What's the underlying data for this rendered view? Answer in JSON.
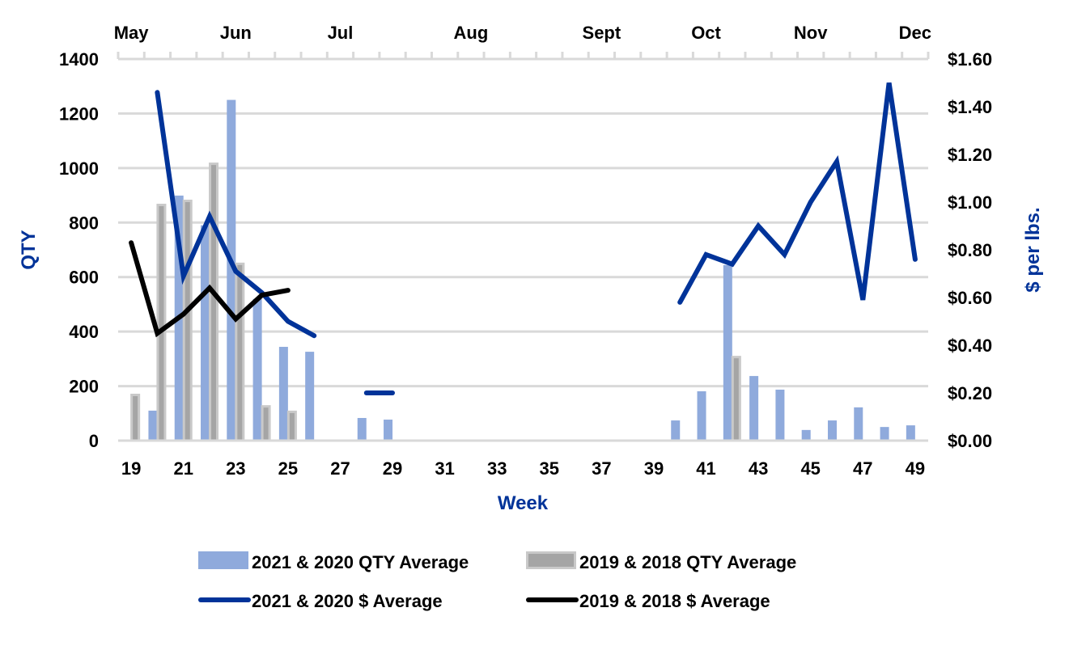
{
  "chart_data": {
    "type": "bar+line",
    "title": "",
    "xlabel": "Week",
    "ylabel": "QTY",
    "y2label": "$ per lbs.",
    "ylim": [
      0,
      1400
    ],
    "y2lim": [
      0,
      1.6
    ],
    "yticks": [
      0,
      200,
      400,
      600,
      800,
      1000,
      1200,
      1400
    ],
    "y2ticks": [
      "$0.00",
      "$0.20",
      "$0.40",
      "$0.60",
      "$0.80",
      "$1.00",
      "$1.20",
      "$1.40",
      "$1.60"
    ],
    "grid": true,
    "legend_position": "bottom",
    "x": [
      19,
      20,
      21,
      22,
      23,
      24,
      25,
      26,
      27,
      28,
      29,
      30,
      31,
      32,
      33,
      34,
      35,
      36,
      37,
      38,
      39,
      40,
      41,
      42,
      43,
      44,
      45,
      46,
      47,
      48,
      49
    ],
    "xtick_labels": [
      "19",
      "21",
      "23",
      "25",
      "27",
      "29",
      "31",
      "33",
      "35",
      "37",
      "39",
      "41",
      "43",
      "45",
      "47",
      "49"
    ],
    "month_labels": [
      {
        "label": "May",
        "week": 19
      },
      {
        "label": "Jun",
        "week": 23
      },
      {
        "label": "Jul",
        "week": 27
      },
      {
        "label": "Aug",
        "week": 32
      },
      {
        "label": "Sept",
        "week": 37
      },
      {
        "label": "Oct",
        "week": 41
      },
      {
        "label": "Nov",
        "week": 45
      },
      {
        "label": "Dec",
        "week": 49
      }
    ],
    "series": [
      {
        "name": "2021 & 2020 QTY Average",
        "kind": "bar",
        "axis": "left",
        "color": "#8faadc",
        "values": [
          null,
          110,
          899,
          790,
          1250,
          520,
          344,
          326,
          null,
          83,
          77,
          null,
          null,
          null,
          null,
          null,
          null,
          null,
          null,
          null,
          null,
          74,
          181,
          644,
          237,
          187,
          39,
          74,
          122,
          50,
          56
        ]
      },
      {
        "name": "2019 & 2018 QTY Average",
        "kind": "bar",
        "axis": "left",
        "color": "#a5a5a5",
        "border": "#c9c9c9",
        "values": [
          172,
          869,
          884,
          1020,
          653,
          130,
          110,
          null,
          null,
          null,
          null,
          null,
          null,
          null,
          null,
          null,
          null,
          null,
          null,
          null,
          null,
          null,
          null,
          311,
          null,
          null,
          null,
          null,
          null,
          null,
          null
        ]
      },
      {
        "name": "2021 & 2020 $ Average",
        "kind": "line",
        "axis": "right",
        "color": "#003399",
        "values": [
          null,
          1.46,
          0.69,
          0.94,
          0.71,
          0.62,
          0.5,
          0.44,
          null,
          0.2,
          0.2,
          null,
          null,
          null,
          null,
          null,
          null,
          null,
          null,
          null,
          null,
          0.58,
          0.78,
          0.74,
          0.9,
          0.78,
          1.0,
          1.17,
          0.59,
          1.5,
          0.76
        ]
      },
      {
        "name": "2019 & 2018 $ Average",
        "kind": "line",
        "axis": "right",
        "color": "#000000",
        "values": [
          0.83,
          0.45,
          0.53,
          0.64,
          0.51,
          0.61,
          0.63,
          null,
          null,
          null,
          null,
          null,
          null,
          null,
          null,
          null,
          null,
          null,
          null,
          null,
          null,
          null,
          null,
          null,
          null,
          null,
          null,
          null,
          null,
          null,
          null
        ]
      }
    ]
  }
}
